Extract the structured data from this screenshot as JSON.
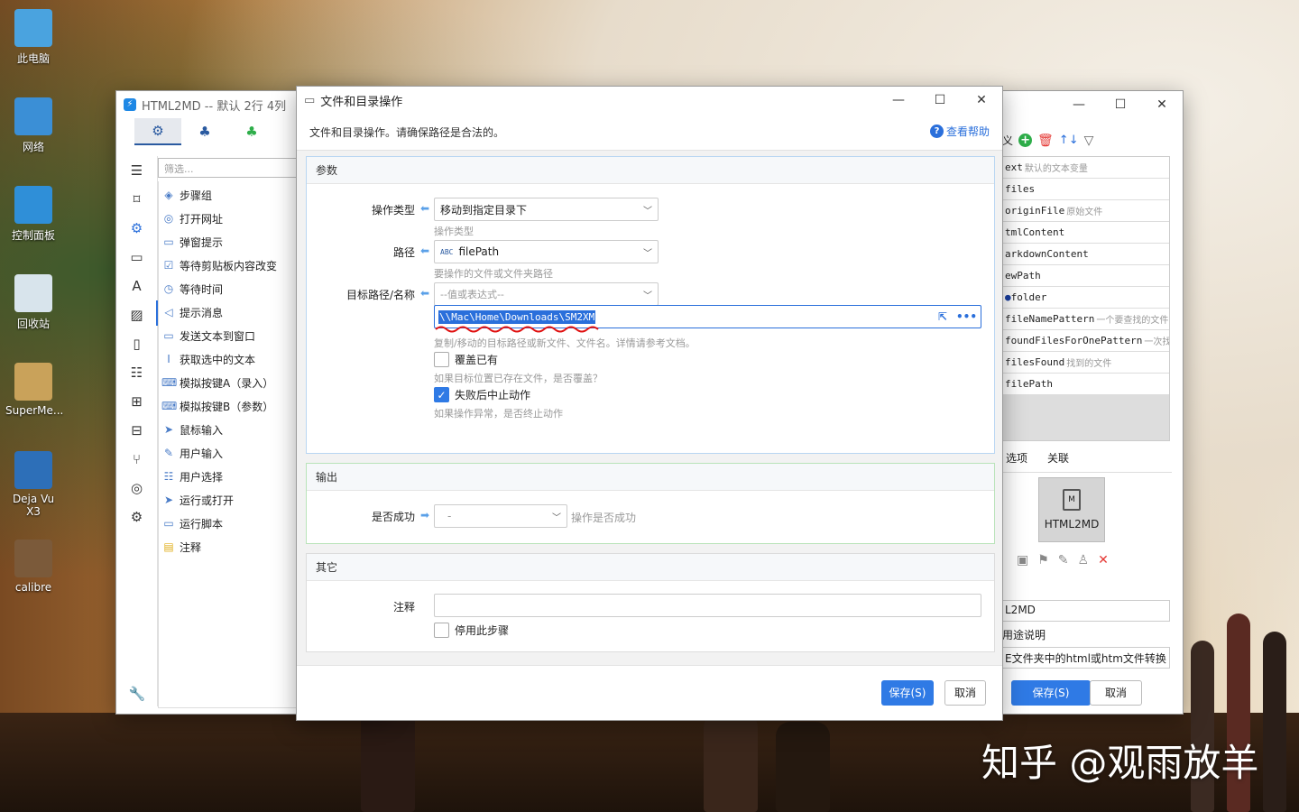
{
  "desktop": {
    "icons": [
      {
        "label": "此电脑",
        "icon": "computer-icon",
        "color": "#4aa3df"
      },
      {
        "label": "网络",
        "icon": "network-icon",
        "color": "#3b8fd6"
      },
      {
        "label": "控制面板",
        "icon": "control-panel-icon",
        "color": "#2f8fd8"
      },
      {
        "label": "回收站",
        "icon": "recycle-bin-icon",
        "color": "#d8e4ec"
      },
      {
        "label": "SuperMe...",
        "icon": "supermemo-icon",
        "color": "#c9a25a"
      },
      {
        "label": "Deja Vu X3",
        "icon": "dejavu-icon",
        "color": "#2d6fb8"
      },
      {
        "label": "calibre",
        "icon": "calibre-icon",
        "color": "#7b5a3a"
      }
    ],
    "watermark": "知乎 @观雨放羊"
  },
  "main_window": {
    "title": "HTML2MD -- 默认 2行 4列",
    "tabs": [
      {
        "icon": "gears-icon",
        "glyph": "⚙"
      },
      {
        "icon": "cubes-icon",
        "glyph": "♣"
      },
      {
        "icon": "green-cubes-icon",
        "glyph": "♣"
      }
    ],
    "filter_placeholder": "筛选...",
    "rail_icons": [
      "menu-icon",
      "bookmark-icon",
      "settings-icon",
      "window-icon",
      "font-icon",
      "image-icon",
      "clipboard-icon",
      "document-icon",
      "windows-icon",
      "grid-icon",
      "branch-icon",
      "globe-icon",
      "advanced-settings-icon",
      "wrench-icon"
    ],
    "steps": [
      {
        "label": "步骤组",
        "icon": "layers-icon"
      },
      {
        "label": "打开网址",
        "icon": "globe-icon"
      },
      {
        "label": "弹窗提示",
        "icon": "popup-icon"
      },
      {
        "label": "等待剪贴板内容改变",
        "icon": "clipboard-check-icon"
      },
      {
        "label": "等待时间",
        "icon": "clock-icon"
      },
      {
        "label": "提示消息",
        "icon": "megaphone-icon"
      },
      {
        "label": "发送文本到窗口",
        "icon": "send-text-icon"
      },
      {
        "label": "获取选中的文本",
        "icon": "text-cursor-icon"
      },
      {
        "label": "模拟按键A（录入）",
        "icon": "keyboard-icon"
      },
      {
        "label": "模拟按键B（参数）",
        "icon": "keyboard-icon"
      },
      {
        "label": "鼠标输入",
        "icon": "pointer-icon"
      },
      {
        "label": "用户输入",
        "icon": "user-input-icon"
      },
      {
        "label": "用户选择",
        "icon": "list-select-icon"
      },
      {
        "label": "运行或打开",
        "icon": "paper-plane-icon"
      },
      {
        "label": "运行脚本",
        "icon": "script-icon"
      },
      {
        "label": "注释",
        "icon": "note-icon"
      }
    ]
  },
  "dialog": {
    "title": "文件和目录操作",
    "description": "文件和目录操作。请确保路径是合法的。",
    "help_label": "查看帮助",
    "params": {
      "section_title": "参数",
      "op_type_label": "操作类型",
      "op_type_value": "移动到指定目录下",
      "op_type_hint": "操作类型",
      "path_label": "路径",
      "path_prefix": "ABC",
      "path_value": "filePath",
      "path_hint": "要操作的文件或文件夹路径",
      "target_label": "目标路径/名称",
      "target_placeholder": "--值或表达式--",
      "target_input_value": "\\\\Mac\\Home\\Downloads\\SM2XM",
      "target_hint": "复制/移动的目标路径或新文件、文件名。详情请参考文档。",
      "overwrite_label": "覆盖已有",
      "overwrite_checked": false,
      "overwrite_hint": "如果目标位置已存在文件，是否覆盖？",
      "abort_label": "失败后中止动作",
      "abort_checked": true,
      "abort_hint": "如果操作异常，是否终止动作"
    },
    "output": {
      "section_title": "输出",
      "success_label": "是否成功",
      "success_value": "-",
      "success_hint": "操作是否成功"
    },
    "other": {
      "section_title": "其它",
      "note_label": "注释",
      "note_value": "",
      "disable_label": "停用此步骤",
      "disable_checked": false
    },
    "save_label": "保存(S)",
    "cancel_label": "取消"
  },
  "right_window": {
    "toolbar_prefix": "义",
    "variables": [
      {
        "name": "text",
        "desc": "默认的文本变量",
        "shown": "ext"
      },
      {
        "name": "files",
        "desc": "",
        "shown": "files"
      },
      {
        "name": "originFile",
        "desc": "原始文件",
        "shown": "originFile"
      },
      {
        "name": "htmlContent",
        "desc": "",
        "shown": "tmlContent"
      },
      {
        "name": "markdownContent",
        "desc": "",
        "shown": "arkdownContent"
      },
      {
        "name": "newPath",
        "desc": "",
        "shown": "ewPath"
      },
      {
        "name": "folder",
        "desc": "",
        "shown": "folder"
      },
      {
        "name": "fileNamePattern",
        "desc": "一个要查找的文件",
        "shown": "fileNamePattern"
      },
      {
        "name": "foundFilesForOnePattern",
        "desc": "一次找",
        "shown": "foundFilesForOnePattern"
      },
      {
        "name": "filesFound",
        "desc": "找到的文件",
        "shown": "filesFound"
      },
      {
        "name": "filePath",
        "desc": "",
        "shown": "filePath"
      }
    ],
    "tabs": [
      "选项",
      "关联"
    ],
    "thumb_label": "HTML2MD",
    "thumb_doc": "M",
    "name_value": "L2MD",
    "purpose_label": "用途说明",
    "purpose_value": "E文件夹中的html或htm文件转换",
    "save_label": "保存(S)",
    "cancel_label": "取消"
  }
}
